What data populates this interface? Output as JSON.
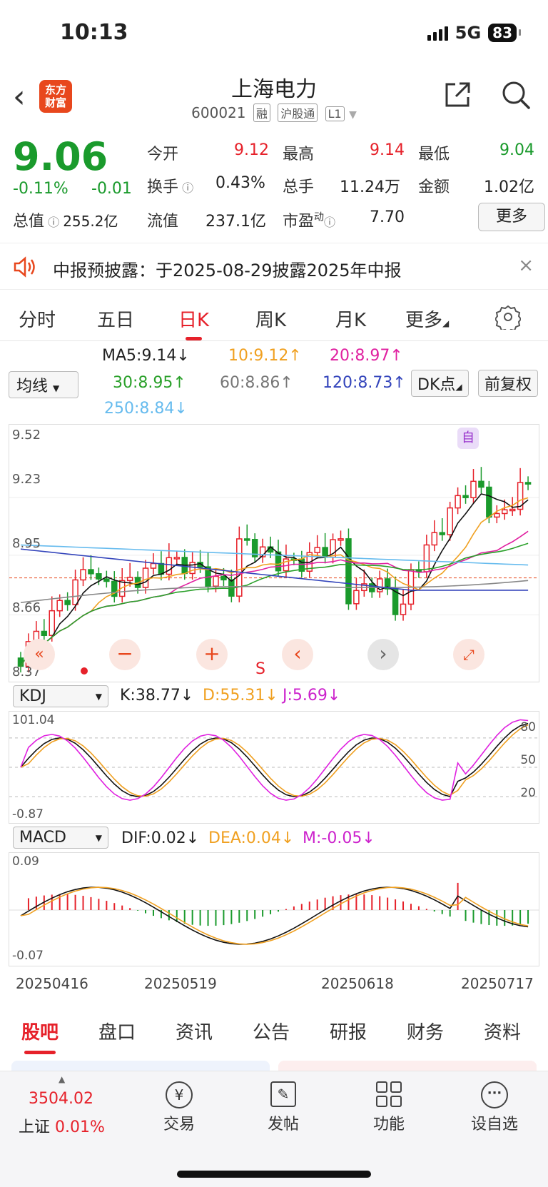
{
  "status": {
    "time": "10:13",
    "network": "5G",
    "battery": "83"
  },
  "header": {
    "title": "上海电力",
    "code": "600021",
    "tags": [
      "融",
      "沪股通",
      "L1"
    ],
    "logo_text": "东方财富"
  },
  "quote": {
    "price": "9.06",
    "change_pct": "-0.11%",
    "change": "-0.01",
    "open_label": "今开",
    "open": "9.12",
    "high_label": "最高",
    "high": "9.14",
    "low_label": "最低",
    "low": "9.04",
    "turnover_label": "换手",
    "turnover": "0.43%",
    "volume_label": "总手",
    "volume": "11.24万",
    "amount_label": "金额",
    "amount": "1.02亿",
    "mktcap_label": "总值",
    "mktcap": "255.2亿",
    "float_label": "流值",
    "float": "237.1亿",
    "pe_label": "市盈",
    "pe_sup": "动",
    "pe": "7.70",
    "more": "更多"
  },
  "notice": {
    "text": "中报预披露：于2025-08-29披露2025年中报"
  },
  "tabs": [
    "分时",
    "五日",
    "日K",
    "周K",
    "月K",
    "更多"
  ],
  "ma": {
    "selector": "均线",
    "ma5": "MA5:9.14↓",
    "ma10": "10:9.12↑",
    "ma20": "20:8.97↑",
    "ma30": "30:8.95↑",
    "ma60": "60:8.86↑",
    "ma120": "120:8.73↑",
    "ma250": "250:8.84↓",
    "dk": "DK点",
    "adjust": "前复权"
  },
  "kline": {
    "y_labels": [
      "9.52",
      "9.23",
      "8.95",
      "8.66",
      "8.37"
    ],
    "marker_self": "自",
    "s_label": "S",
    "colors": {
      "up": "#e6212a",
      "down": "#1a9a2c",
      "ma5": "#111111",
      "ma10": "#f0a020",
      "ma20": "#e020a0",
      "ma30": "#2aa02a",
      "ma60": "#888888",
      "ma120": "#3344bb",
      "ma250": "#66bbee"
    }
  },
  "kdj": {
    "selector": "KDJ",
    "k": "K:38.77↓",
    "d": "D:55.31↓",
    "j": "J:5.69↓",
    "top": "101.04",
    "bottom": "-0.87",
    "levels": [
      "80",
      "50",
      "20"
    ]
  },
  "macd": {
    "selector": "MACD",
    "dif": "DIF:0.02↓",
    "dea": "DEA:0.04↓",
    "m": "M:-0.05↓",
    "top": "0.09",
    "bottom": "-0.07"
  },
  "dates": [
    "20250416",
    "20250519",
    "20250618",
    "20250717"
  ],
  "bottom_tabs": [
    "股吧",
    "盘口",
    "资讯",
    "公告",
    "研报",
    "财务",
    "资料"
  ],
  "toolbar": {
    "index_value": "3504.02",
    "index_name": "上证",
    "index_change": "0.01%",
    "items": [
      "交易",
      "发帖",
      "功能",
      "设自选"
    ]
  }
}
